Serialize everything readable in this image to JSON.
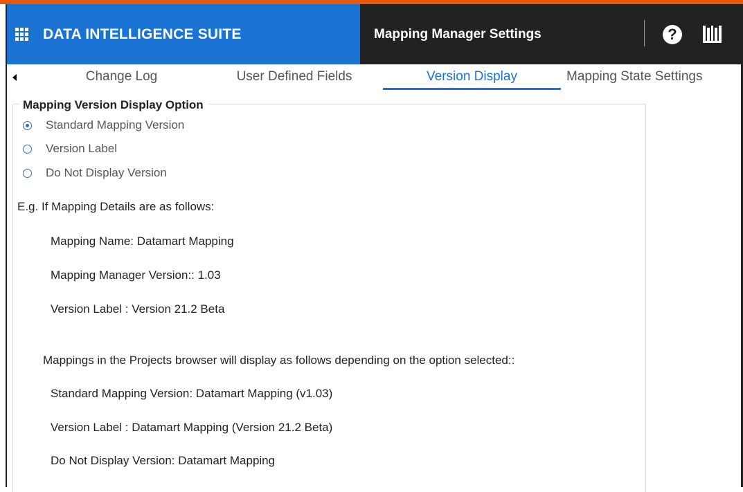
{
  "header": {
    "app_title": "DATA INTELLIGENCE SUITE",
    "page_title": "Mapping Manager Settings",
    "brand_color": "#1a73d3",
    "icons": [
      "apps-grid-icon",
      "help-icon",
      "library-icon"
    ]
  },
  "tabs": [
    {
      "label": "Change Log"
    },
    {
      "label": "User Defined Fields"
    },
    {
      "label": "Version Display"
    },
    {
      "label": "Mapping State Settings"
    }
  ],
  "active_tab": "Version Display",
  "section": {
    "legend": "Mapping Version Display Option",
    "options": [
      {
        "label": "Standard Mapping Version",
        "selected": true
      },
      {
        "label": "Version Label",
        "selected": false
      },
      {
        "label": "Do Not Display Version",
        "selected": false
      }
    ],
    "example_intro": "E.g. If Mapping Details are as follows:",
    "details": [
      "Mapping Name: Datamart Mapping",
      "Mapping Manager Version:: 1.03",
      "Version Label : Version 21.2 Beta"
    ],
    "display_intro": "Mappings in the Projects browser will display as follows depending on the option selected::",
    "display_examples": [
      "Standard Mapping Version: Datamart Mapping (v1.03)",
      "Version Label : Datamart Mapping (Version 21.2 Beta)",
      "Do Not Display Version: Datamart Mapping"
    ]
  }
}
